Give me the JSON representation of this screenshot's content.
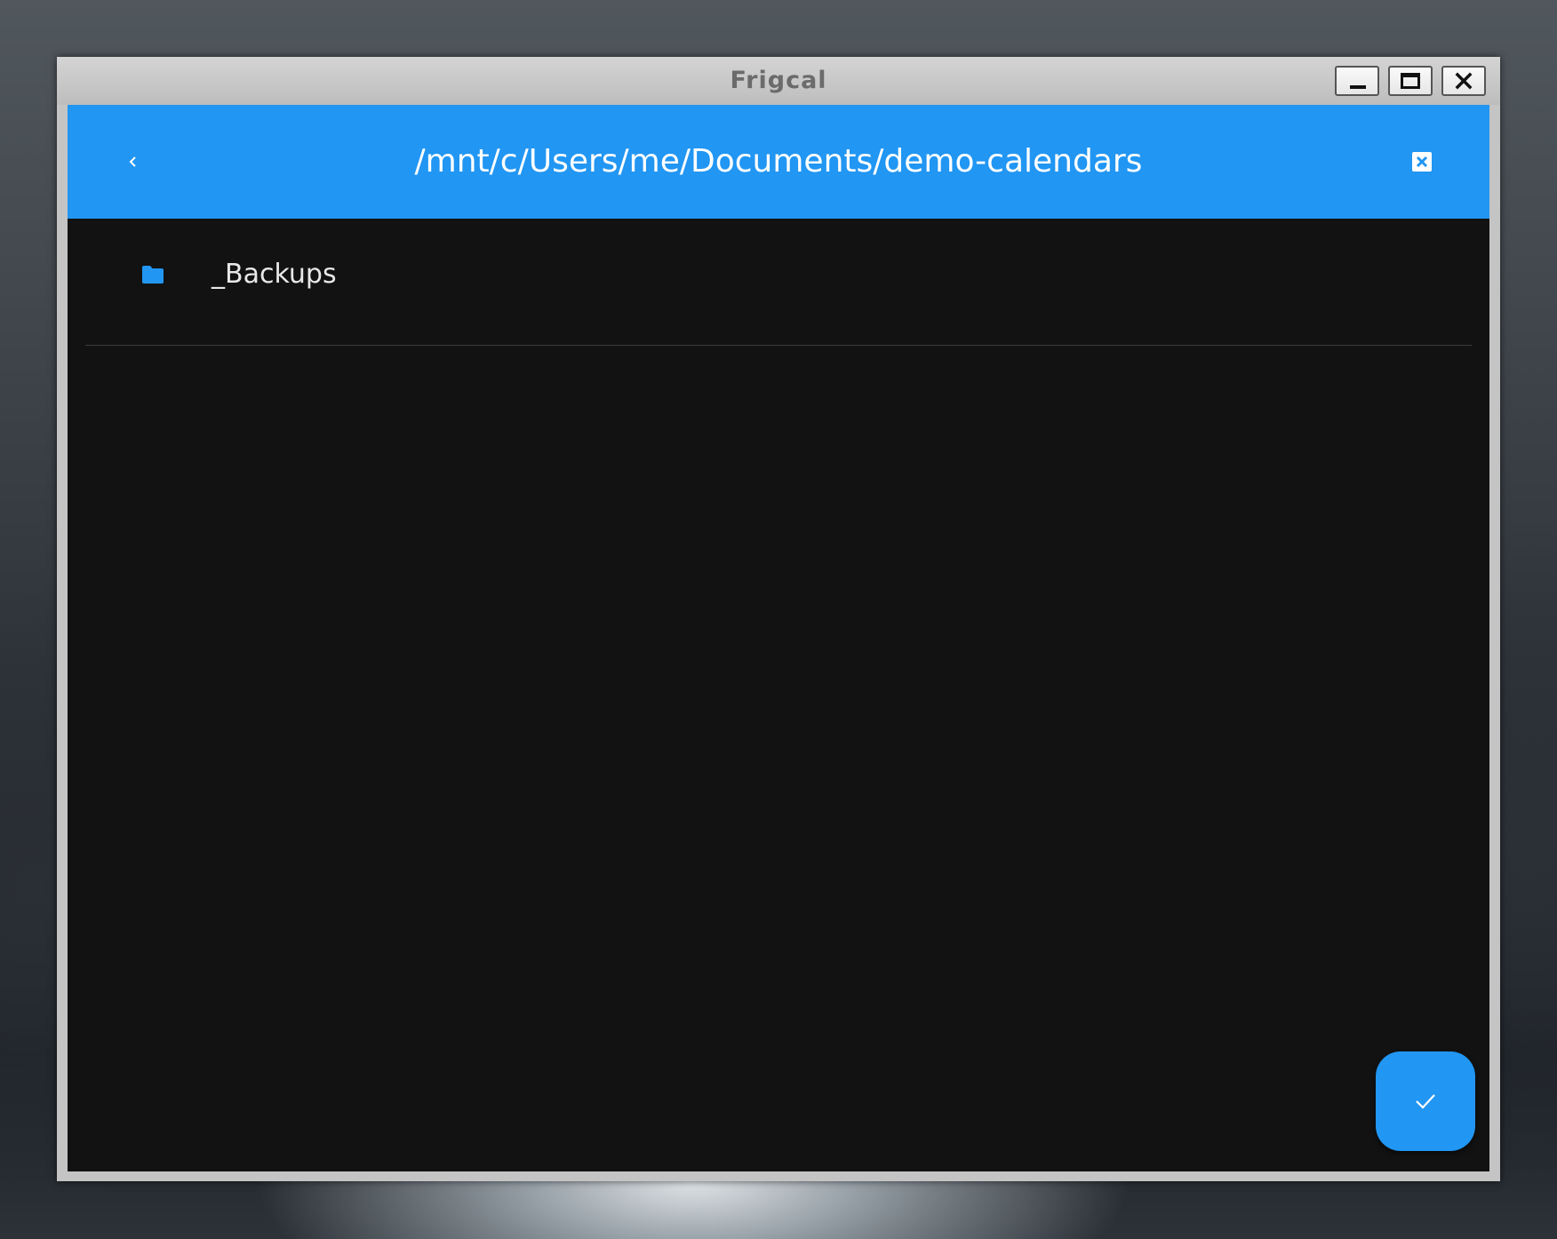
{
  "window": {
    "title": "Frigcal",
    "controls": {
      "minimize_icon": "minimize-icon",
      "maximize_icon": "maximize-icon",
      "close_icon": "close-icon"
    }
  },
  "app_bar": {
    "back_icon": "chevron-left-icon",
    "path": "/mnt/c/Users/me/Documents/demo-calendars",
    "close_icon": "close-box-icon",
    "color": "#2196f3"
  },
  "file_list": {
    "items": [
      {
        "label": "_Backups",
        "icon": "folder-icon",
        "icon_color": "#2196f3"
      }
    ]
  },
  "fab": {
    "icon": "check-icon",
    "color": "#2196f3"
  },
  "colors": {
    "background": "#121212",
    "text": "#e8e8e8",
    "divider": "#3c3c3c"
  }
}
